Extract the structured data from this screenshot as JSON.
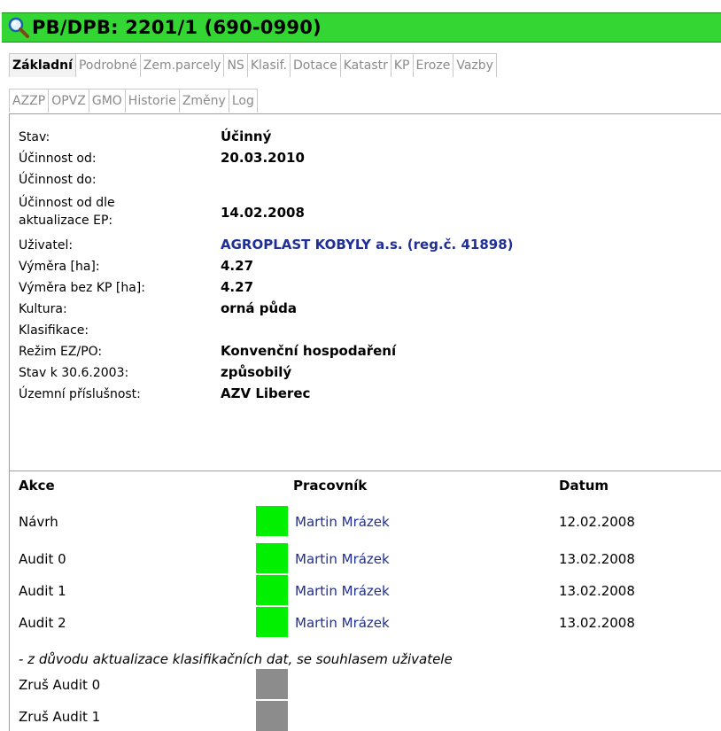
{
  "title": "PB/DPB: 2201/1 (690-0990)",
  "colors": {
    "titlebar": "#33d633",
    "status_ok": "#00f000",
    "status_inactive": "#8c8c8c",
    "link": "#1f2f96"
  },
  "tabs_row1": [
    "Základní",
    "Podrobné",
    "Zem.parcely",
    "NS",
    "Klasif.",
    "Dotace",
    "Katastr",
    "KP",
    "Eroze",
    "Vazby"
  ],
  "tabs_row2": [
    "AZZP",
    "OPVZ",
    "GMO",
    "Historie",
    "Změny",
    "Log"
  ],
  "active_tab": "Základní",
  "info": {
    "stav": {
      "label": "Stav:",
      "value": "Účinný"
    },
    "ucinnost_od": {
      "label": "Účinnost od:",
      "value": "20.03.2010"
    },
    "ucinnost_do": {
      "label": "Účinnost do:",
      "value": ""
    },
    "ucinnost_ep": {
      "label_line1": "Účinnost od dle",
      "label_line2": "aktualizace EP:",
      "value": "14.02.2008"
    },
    "uzivatel": {
      "label": "Uživatel:",
      "value": "AGROPLAST KOBYLY a.s. (reg.č. 41898)"
    },
    "vymera": {
      "label": "Výměra [ha]:",
      "value": "4.27"
    },
    "vymera_bez_kp": {
      "label": "Výměra bez KP [ha]:",
      "value": "4.27"
    },
    "kultura": {
      "label": "Kultura:",
      "value": "orná půda"
    },
    "klasifikace": {
      "label": "Klasifikace:",
      "value": ""
    },
    "rezim": {
      "label": "Režim EZ/PO:",
      "value": "Konvenční hospodaření"
    },
    "stav_2003": {
      "label": "Stav k 30.6.2003:",
      "value": "způsobilý"
    },
    "uzemni": {
      "label": "Územní příslušnost:",
      "value": "AZV Liberec"
    }
  },
  "actions": {
    "headers": {
      "akce": "Akce",
      "pracovnik": "Pracovník",
      "datum": "Datum"
    },
    "rows": [
      {
        "akce": "Návrh",
        "pracovnik": "Martin Mrázek",
        "datum": "12.02.2008",
        "status": "ok"
      },
      {
        "akce": "Audit 0",
        "pracovnik": "Martin Mrázek",
        "datum": "13.02.2008",
        "status": "ok"
      },
      {
        "akce": "Audit 1",
        "pracovnik": "Martin Mrázek",
        "datum": "13.02.2008",
        "status": "ok"
      },
      {
        "akce": "Audit 2",
        "pracovnik": "Martin Mrázek",
        "datum": "13.02.2008",
        "status": "ok"
      }
    ],
    "note": "- z důvodu aktualizace klasifikačních dat, se souhlasem uživatele",
    "cancel_rows": [
      {
        "akce": "Zruš Audit 0",
        "status": "inactive"
      },
      {
        "akce": "Zruš Audit 1",
        "status": "inactive"
      }
    ]
  }
}
